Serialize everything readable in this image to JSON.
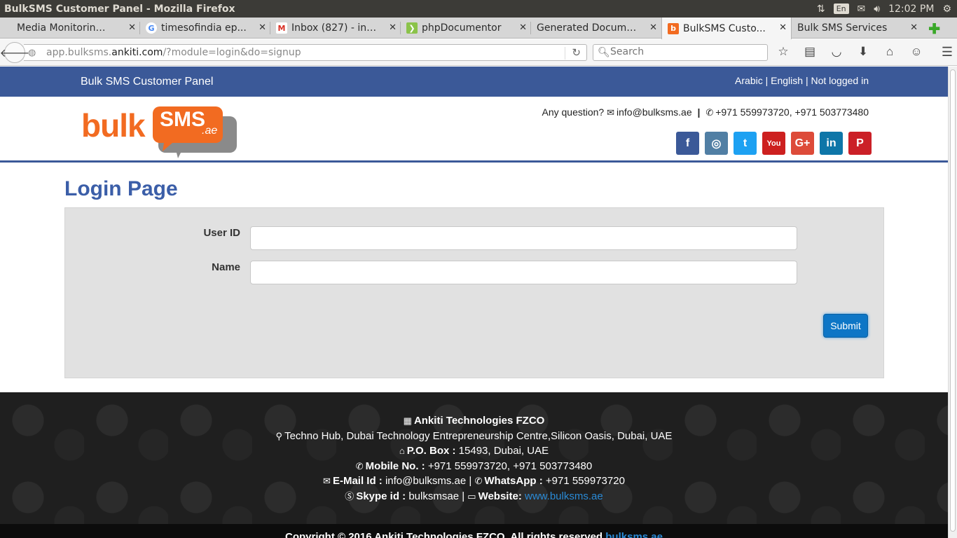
{
  "os": {
    "window_title": "BulkSMS Customer Panel - Mozilla Firefox",
    "lang": "En",
    "time": "12:02 PM"
  },
  "tabs": [
    {
      "label": "Media Monitoring T...",
      "favicon": ""
    },
    {
      "label": "timesofindia ep...",
      "favicon": "G"
    },
    {
      "label": "Inbox (827) - indr...",
      "favicon": "M"
    },
    {
      "label": "phpDocumentor",
      "favicon": ""
    },
    {
      "label": "Generated Docume...",
      "favicon": ""
    },
    {
      "label": "BulkSMS Custo...",
      "favicon": "b"
    },
    {
      "label": "Bulk SMS Services",
      "favicon": ""
    }
  ],
  "navbar": {
    "url_prefix": "app.bulksms.",
    "url_domain": "ankiti.com",
    "url_suffix": "/?module=login&do=signup",
    "search_placeholder": "Search"
  },
  "page": {
    "panel_title": "Bulk SMS Customer Panel",
    "top_links": {
      "arabic": "Arabic",
      "english": "English",
      "status": "Not logged in",
      "separator": "|"
    },
    "logo": {
      "bulk": "bulk",
      "sms": "SMS",
      "ae": ".ae"
    },
    "contact": {
      "question": "Any question?",
      "email": "info@bulksms.ae",
      "phones": "+971 559973720, +971 503773480"
    },
    "socials": [
      {
        "name": "facebook",
        "glyph": "f",
        "color": "#3b5998"
      },
      {
        "name": "instagram",
        "glyph": "◎",
        "color": "#517fa4"
      },
      {
        "name": "twitter",
        "glyph": "t",
        "color": "#1da1f2"
      },
      {
        "name": "youtube",
        "glyph": "You",
        "color": "#cd201f"
      },
      {
        "name": "google-plus",
        "glyph": "G+",
        "color": "#dd4b39"
      },
      {
        "name": "linkedin",
        "glyph": "in",
        "color": "#0e76a8"
      },
      {
        "name": "pinterest",
        "glyph": "P",
        "color": "#cb2027"
      }
    ],
    "login": {
      "heading": "Login Page",
      "user_id_label": "User ID",
      "name_label": "Name",
      "user_id_value": "",
      "name_value": "",
      "submit_label": "Submit"
    },
    "footer": {
      "company": "Ankiti Technologies FZCO",
      "address": "Techno Hub, Dubai Technology Entrepreneurship Centre,Silicon Oasis, Dubai, UAE",
      "po_box_label": "P.O. Box :",
      "po_box_value": "15493, Dubai, UAE",
      "mobile_label": "Mobile No. :",
      "mobile_value": "+971 559973720, +971 503773480",
      "email_label": "E-Mail Id :",
      "email_value": "info@bulksms.ae",
      "whatsapp_label": "WhatsApp :",
      "whatsapp_value": "+971 559973720",
      "skype_label": "Skype id :",
      "skype_value": "bulksmsae",
      "website_label": "Website:",
      "website_value": "www.bulksms.ae",
      "copyright_text": "Copyright © 2016 Ankiti Technologies FZCO. All rights reserved",
      "copyright_link": "bulksms.ae"
    }
  },
  "colors": {
    "brand_blue": "#3b5998",
    "logo_orange": "#f26b21",
    "submit_blue": "#0d76c6"
  }
}
